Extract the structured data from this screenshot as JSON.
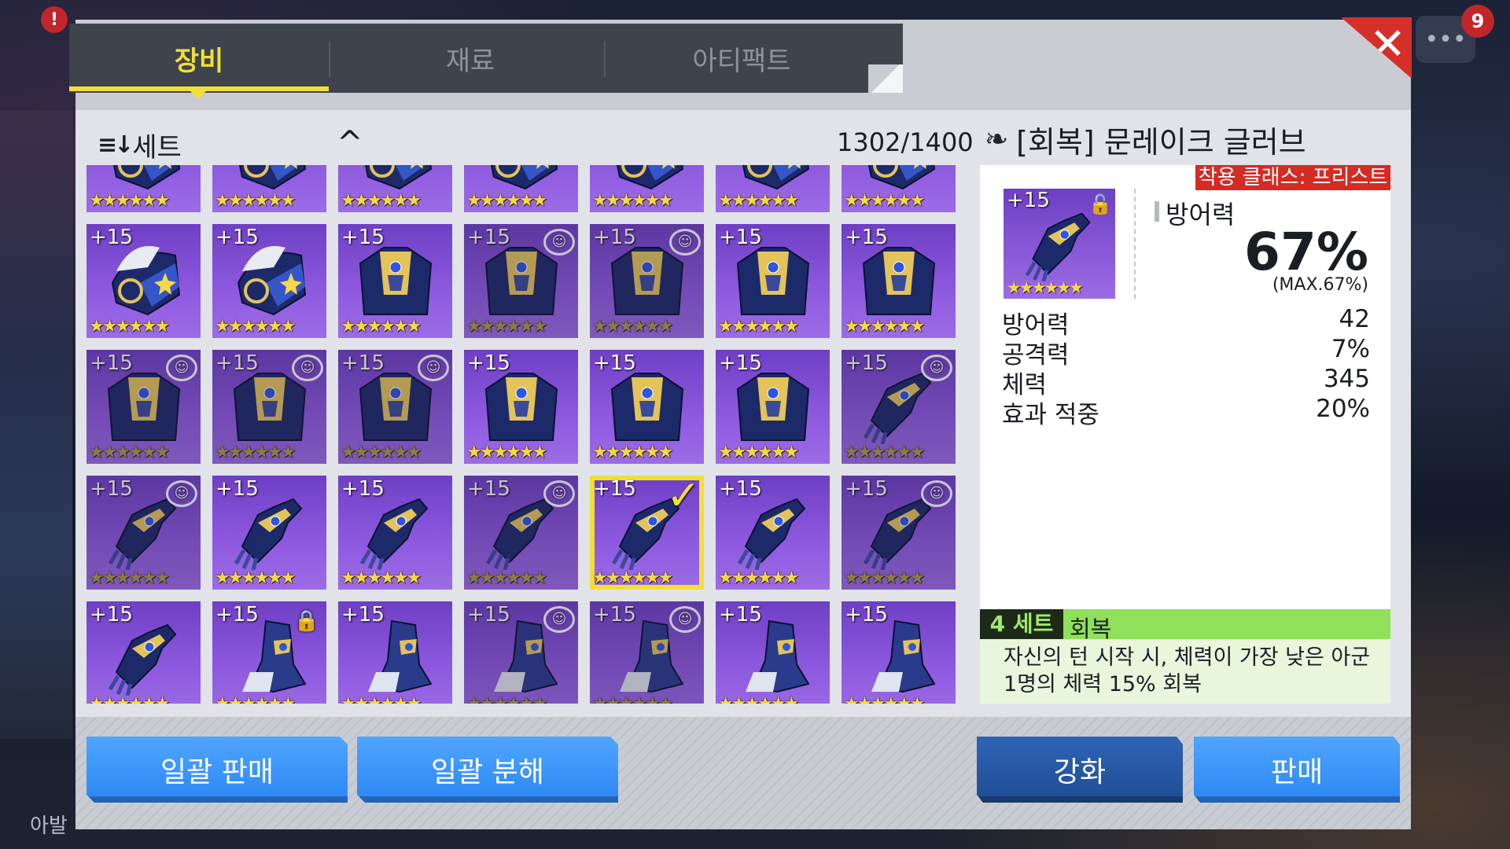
{
  "tabs": [
    {
      "label": "장비",
      "active": true
    },
    {
      "label": "재료",
      "active": false
    },
    {
      "label": "아티팩트",
      "active": false
    }
  ],
  "close_label": "✕",
  "sort": {
    "icon": "sort-icon",
    "label": "세트"
  },
  "inventory_count": "1302/1400",
  "grid": {
    "rows": [
      [
        {
          "level": "",
          "type": "helmet",
          "equipped": false,
          "locked": false
        },
        {
          "level": "",
          "type": "helmet",
          "equipped": false,
          "locked": false
        },
        {
          "level": "",
          "type": "helmet",
          "equipped": false,
          "locked": false
        },
        {
          "level": "",
          "type": "helmet",
          "equipped": false,
          "locked": false
        },
        {
          "level": "",
          "type": "helmet",
          "equipped": false,
          "locked": false
        },
        {
          "level": "",
          "type": "helmet",
          "equipped": false,
          "locked": false
        },
        {
          "level": "",
          "type": "helmet",
          "equipped": false,
          "locked": false
        }
      ],
      [
        {
          "level": "+15",
          "type": "helmet",
          "equipped": false,
          "locked": false
        },
        {
          "level": "+15",
          "type": "helmet",
          "equipped": false,
          "locked": false
        },
        {
          "level": "+15",
          "type": "armor",
          "equipped": false,
          "locked": false
        },
        {
          "level": "+15",
          "type": "armor",
          "equipped": true,
          "locked": false
        },
        {
          "level": "+15",
          "type": "armor",
          "equipped": true,
          "locked": false
        },
        {
          "level": "+15",
          "type": "armor",
          "equipped": false,
          "locked": false
        },
        {
          "level": "+15",
          "type": "armor",
          "equipped": false,
          "locked": false
        }
      ],
      [
        {
          "level": "+15",
          "type": "armor",
          "equipped": true,
          "locked": false
        },
        {
          "level": "+15",
          "type": "armor",
          "equipped": true,
          "locked": false
        },
        {
          "level": "+15",
          "type": "armor",
          "equipped": true,
          "locked": false
        },
        {
          "level": "+15",
          "type": "armor",
          "equipped": false,
          "locked": false
        },
        {
          "level": "+15",
          "type": "armor",
          "equipped": false,
          "locked": false
        },
        {
          "level": "+15",
          "type": "armor",
          "equipped": false,
          "locked": false
        },
        {
          "level": "+15",
          "type": "glove",
          "equipped": true,
          "locked": false
        }
      ],
      [
        {
          "level": "+15",
          "type": "glove",
          "equipped": true,
          "locked": false
        },
        {
          "level": "+15",
          "type": "glove",
          "equipped": false,
          "locked": false
        },
        {
          "level": "+15",
          "type": "glove",
          "equipped": false,
          "locked": false
        },
        {
          "level": "+15",
          "type": "glove",
          "equipped": true,
          "locked": false
        },
        {
          "level": "+15",
          "type": "glove",
          "equipped": false,
          "locked": false,
          "selected": true
        },
        {
          "level": "+15",
          "type": "glove",
          "equipped": false,
          "locked": false
        },
        {
          "level": "+15",
          "type": "glove",
          "equipped": true,
          "locked": false
        }
      ],
      [
        {
          "level": "+15",
          "type": "glove",
          "equipped": false,
          "locked": false
        },
        {
          "level": "+15",
          "type": "boots",
          "equipped": false,
          "locked": true
        },
        {
          "level": "+15",
          "type": "boots",
          "equipped": false,
          "locked": false
        },
        {
          "level": "+15",
          "type": "boots",
          "equipped": true,
          "locked": false
        },
        {
          "level": "+15",
          "type": "boots",
          "equipped": true,
          "locked": false
        },
        {
          "level": "+15",
          "type": "boots",
          "equipped": false,
          "locked": false
        },
        {
          "level": "+15",
          "type": "boots",
          "equipped": false,
          "locked": false
        }
      ]
    ],
    "stars": "★★★★★★"
  },
  "detail": {
    "name": "[회복] 문레이크 글러브",
    "class_badge": "착용 클래스: 프리스트",
    "level": "+15",
    "main_stat": {
      "label": "방어력",
      "value": "67%",
      "max": "(MAX.67%)"
    },
    "substats": [
      {
        "label": "방어력",
        "value": "42"
      },
      {
        "label": "공격력",
        "value": "7%"
      },
      {
        "label": "체력",
        "value": "345"
      },
      {
        "label": "효과 적중",
        "value": "20%"
      }
    ],
    "set": {
      "count": "4 세트",
      "name": "회복",
      "description": "자신의 턴 시작 시, 체력이 가장 낮은 아군 1명의 체력 15% 회복"
    }
  },
  "buttons": {
    "bulk_sell": "일괄 판매",
    "bulk_dismantle": "일괄 분해",
    "enhance": "강화",
    "sell": "판매"
  },
  "background": {
    "bottom_left_text": "아발",
    "badge_count": "9",
    "alert_badge": "!"
  }
}
